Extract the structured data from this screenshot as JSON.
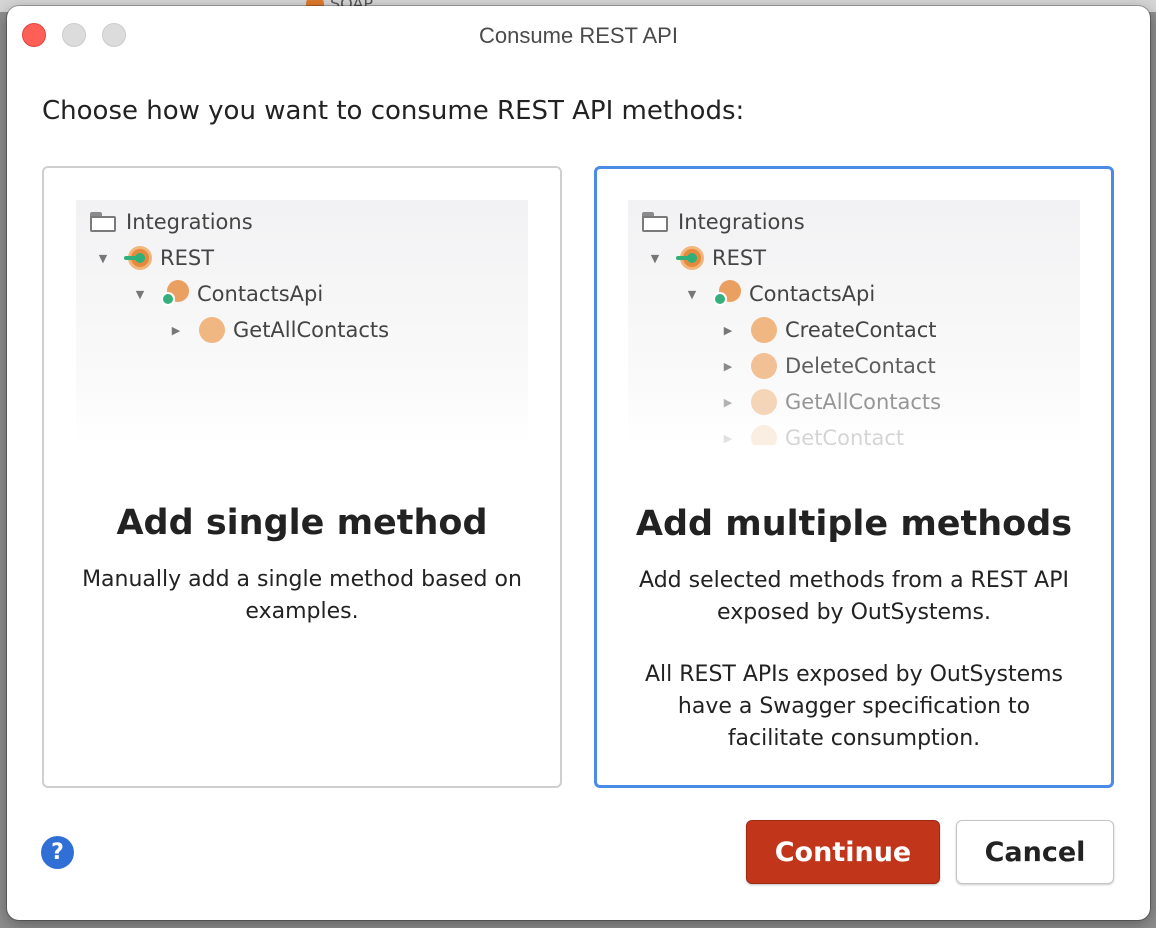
{
  "background": {
    "peek_label": "SOAP"
  },
  "window": {
    "title": "Consume REST API",
    "controls": [
      "close",
      "minimize",
      "maximize"
    ]
  },
  "prompt": "Choose how you want to consume REST API methods:",
  "cards": {
    "single": {
      "selected": false,
      "title": "Add single method",
      "description": "Manually add a single method based on examples.",
      "tree": {
        "root": "Integrations",
        "rest": "REST",
        "api": "ContactsApi",
        "methods": [
          "GetAllContacts"
        ]
      }
    },
    "multi": {
      "selected": true,
      "title": "Add multiple methods",
      "description": "Add selected methods from a REST API exposed by OutSystems.",
      "note": "All REST APIs exposed by OutSystems have a Swagger specification to facilitate consumption.",
      "tree": {
        "root": "Integrations",
        "rest": "REST",
        "api": "ContactsApi",
        "methods": [
          "CreateContact",
          "DeleteContact",
          "GetAllContacts",
          "GetContact"
        ]
      }
    }
  },
  "footer": {
    "help_label": "?",
    "continue_label": "Continue",
    "cancel_label": "Cancel"
  },
  "colors": {
    "accent_selected": "#4a8be6",
    "primary_button": "#c1351b",
    "help": "#2f6fd6"
  }
}
